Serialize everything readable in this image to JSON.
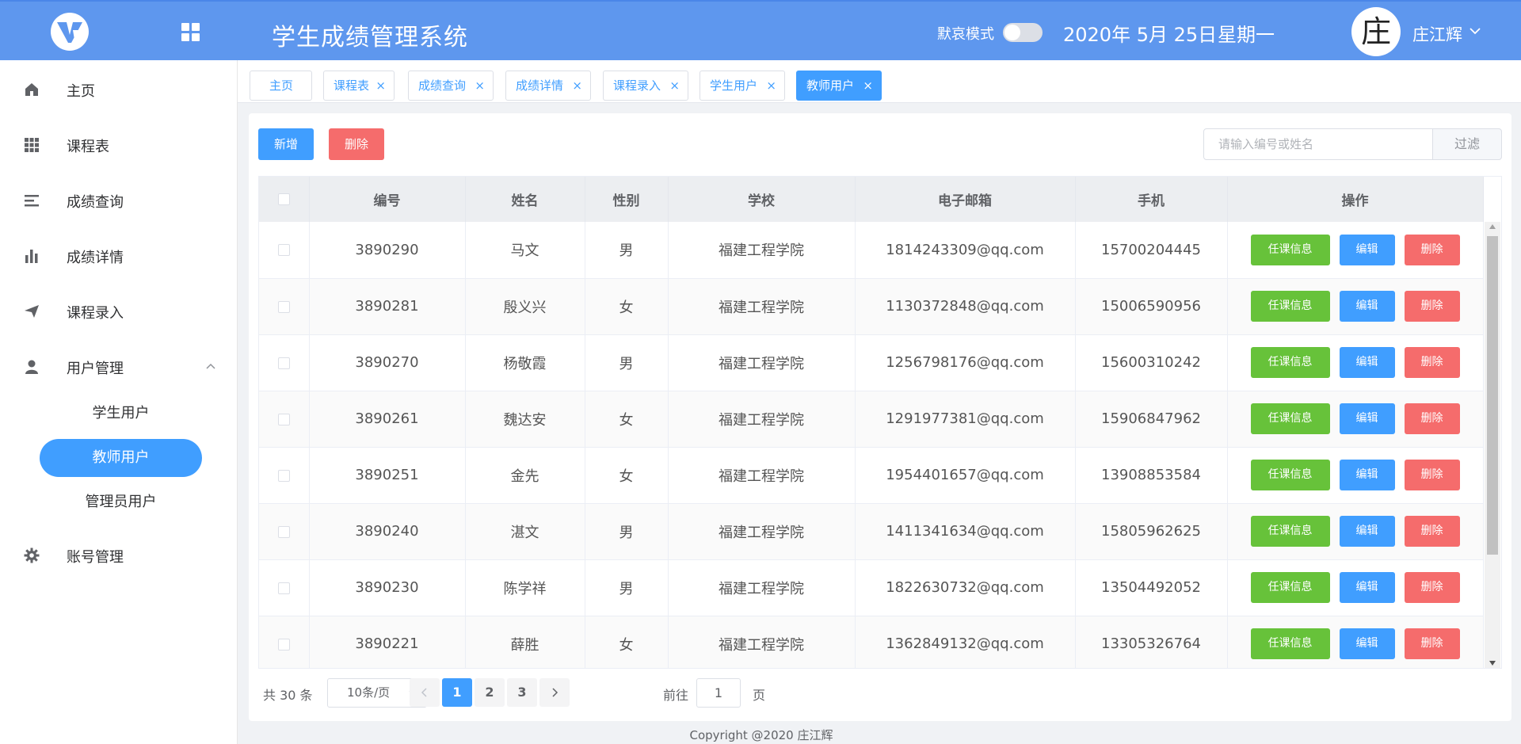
{
  "header": {
    "title": "学生成绩管理系统",
    "dark_mode_label": "默哀模式",
    "date": "2020年 5月 25日",
    "weekday": "星期一",
    "avatar_char": "庄",
    "username": "庄江辉",
    "brand_color": "#5e97ee"
  },
  "sidebar": {
    "items": [
      {
        "label": "主页",
        "icon": "home-icon"
      },
      {
        "label": "课程表",
        "icon": "grid-icon"
      },
      {
        "label": "成绩查询",
        "icon": "list-icon"
      },
      {
        "label": "成绩详情",
        "icon": "bar-chart-icon"
      },
      {
        "label": "课程录入",
        "icon": "send-icon"
      },
      {
        "label": "用户管理",
        "icon": "user-icon"
      },
      {
        "label": "账号管理",
        "icon": "gear-icon"
      }
    ],
    "user_submenu": [
      "学生用户",
      "教师用户",
      "管理员用户"
    ],
    "active_sub": "教师用户"
  },
  "tabs": [
    {
      "label": "主页",
      "closable": false
    },
    {
      "label": "课程表",
      "closable": true
    },
    {
      "label": "成绩查询",
      "closable": true
    },
    {
      "label": "成绩详情",
      "closable": true
    },
    {
      "label": "课程录入",
      "closable": true
    },
    {
      "label": "学生用户",
      "closable": true
    },
    {
      "label": "教师用户",
      "closable": true,
      "active": true
    }
  ],
  "toolbar": {
    "add_label": "新增",
    "delete_label": "删除",
    "search_placeholder": "请输入编号或姓名",
    "filter_label": "过滤"
  },
  "table": {
    "columns": [
      "编号",
      "姓名",
      "性别",
      "学校",
      "电子邮箱",
      "手机",
      "操作"
    ],
    "rows": [
      {
        "id": "3890290",
        "name": "马文",
        "gender": "男",
        "school": "福建工程学院",
        "email": "1814243309@qq.com",
        "phone": "15700204445"
      },
      {
        "id": "3890281",
        "name": "殷义兴",
        "gender": "女",
        "school": "福建工程学院",
        "email": "1130372848@qq.com",
        "phone": "15006590956"
      },
      {
        "id": "3890270",
        "name": "杨敬霞",
        "gender": "男",
        "school": "福建工程学院",
        "email": "1256798176@qq.com",
        "phone": "15600310242"
      },
      {
        "id": "3890261",
        "name": "魏达安",
        "gender": "女",
        "school": "福建工程学院",
        "email": "1291977381@qq.com",
        "phone": "15906847962"
      },
      {
        "id": "3890251",
        "name": "金先",
        "gender": "女",
        "school": "福建工程学院",
        "email": "1954401657@qq.com",
        "phone": "13908853584"
      },
      {
        "id": "3890240",
        "name": "湛文",
        "gender": "男",
        "school": "福建工程学院",
        "email": "1411341634@qq.com",
        "phone": "15805962625"
      },
      {
        "id": "3890230",
        "name": "陈学祥",
        "gender": "男",
        "school": "福建工程学院",
        "email": "1822630732@qq.com",
        "phone": "13504492052"
      },
      {
        "id": "3890221",
        "name": "薛胜",
        "gender": "女",
        "school": "福建工程学院",
        "email": "1362849132@qq.com",
        "phone": "13305326764"
      }
    ],
    "actions": {
      "info": "任课信息",
      "edit": "编辑",
      "delete": "删除"
    }
  },
  "pagination": {
    "total_text": "共 30 条",
    "page_size": "10条/页",
    "pages": [
      "1",
      "2",
      "3"
    ],
    "current_page": "1",
    "goto_label": "前往",
    "goto_value": "1",
    "goto_suffix": "页"
  },
  "footer": {
    "copyright": "Copyright @2020 庄江辉"
  }
}
